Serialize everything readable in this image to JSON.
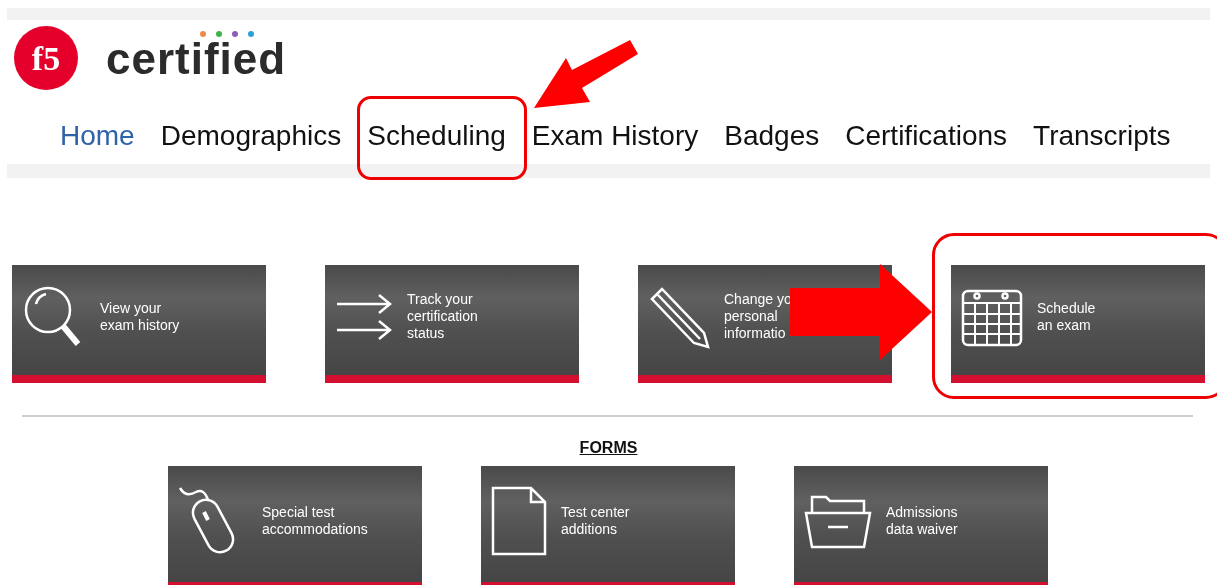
{
  "logo": {
    "mark": "f5",
    "wordmark": "certified"
  },
  "nav": [
    {
      "label": "Home",
      "selected": true
    },
    {
      "label": "Demographics",
      "selected": false
    },
    {
      "label": "Scheduling",
      "selected": false
    },
    {
      "label": "Exam History",
      "selected": false
    },
    {
      "label": "Badges",
      "selected": false
    },
    {
      "label": "Certifications",
      "selected": false
    },
    {
      "label": "Transcripts",
      "selected": false
    }
  ],
  "tiles": [
    {
      "kind": "magnifier",
      "lines": [
        "View your",
        "exam history"
      ]
    },
    {
      "kind": "arrows",
      "lines": [
        "Track your",
        "certification",
        "status"
      ]
    },
    {
      "kind": "pencil",
      "lines": [
        "Change yo",
        "personal",
        "informatio"
      ]
    },
    {
      "kind": "calendar",
      "lines": [
        "Schedule",
        "an exam"
      ]
    }
  ],
  "forms": {
    "heading": "FORMS",
    "tiles": [
      {
        "kind": "mouse",
        "lines": [
          "Special test",
          "accommodations"
        ]
      },
      {
        "kind": "document",
        "lines": [
          "Test center",
          "additions"
        ]
      },
      {
        "kind": "folder",
        "lines": [
          "Admissions",
          "data waiver"
        ]
      }
    ]
  }
}
